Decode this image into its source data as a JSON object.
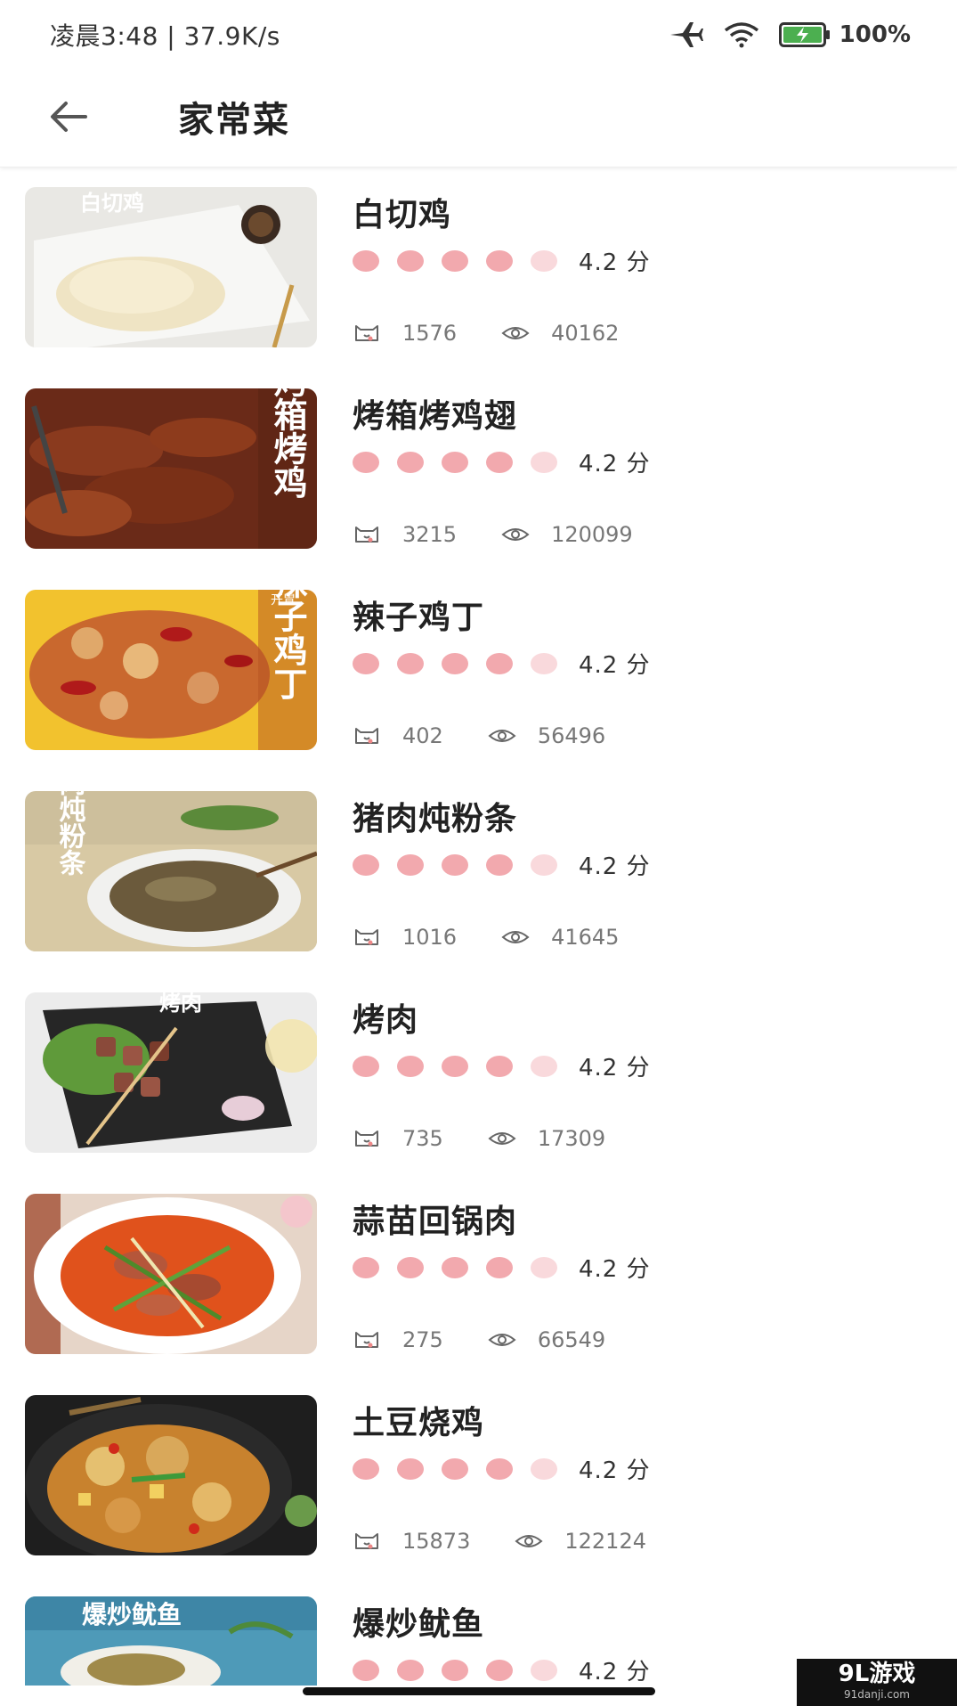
{
  "status_bar": {
    "time_speed": "凌晨3:48 | 37.9K/s",
    "battery": "100%"
  },
  "header": {
    "title": "家常菜"
  },
  "colors": {
    "rating_dot": "#f2a9ae",
    "rating_dot_light": "#f9d9dc"
  },
  "recipes": [
    {
      "title": "白切鸡",
      "score": "4.2 分",
      "likes": "1576",
      "views": "40162",
      "filled_dots": 4
    },
    {
      "title": "烤箱烤鸡翅",
      "score": "4.2 分",
      "likes": "3215",
      "views": "120099",
      "filled_dots": 4
    },
    {
      "title": "辣子鸡丁",
      "score": "4.2 分",
      "likes": "402",
      "views": "56496",
      "filled_dots": 4
    },
    {
      "title": "猪肉炖粉条",
      "score": "4.2 分",
      "likes": "1016",
      "views": "41645",
      "filled_dots": 4
    },
    {
      "title": "烤肉",
      "score": "4.2 分",
      "likes": "735",
      "views": "17309",
      "filled_dots": 4
    },
    {
      "title": "蒜苗回锅肉",
      "score": "4.2 分",
      "likes": "275",
      "views": "66549",
      "filled_dots": 4
    },
    {
      "title": "土豆烧鸡",
      "score": "4.2 分",
      "likes": "15873",
      "views": "122124",
      "filled_dots": 4
    },
    {
      "title": "爆炒鱿鱼",
      "score": "4.2 分",
      "likes": "",
      "views": "",
      "filled_dots": 4
    }
  ],
  "thumbnail_texts": [
    "白切鸡",
    "烤箱烤鸡",
    "辣子鸡丁",
    "猪肉炖粉条",
    "烤肉",
    "",
    "",
    "爆炒鱿鱼"
  ],
  "thumbnail_badges": [
    "",
    "",
    "开胃",
    "",
    "",
    "",
    "",
    ""
  ],
  "watermark": {
    "main": "9L游戏",
    "sub": "91danji.com"
  }
}
